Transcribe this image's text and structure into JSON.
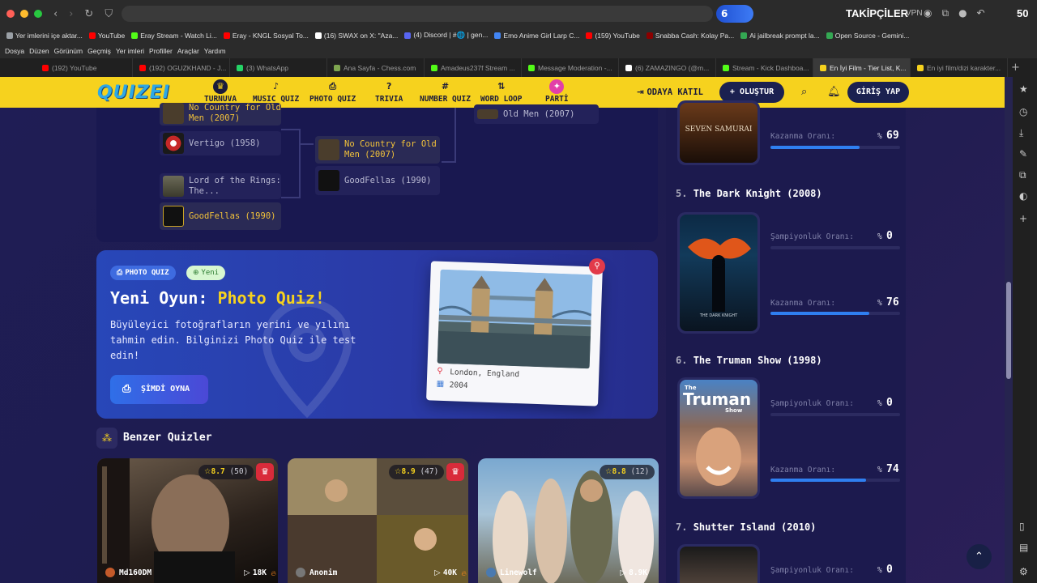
{
  "browser": {
    "extension_count": "6",
    "overlay_text": "TAKİPÇİLER",
    "vpn_text": "VPN",
    "counter": "50",
    "bookmarks": [
      {
        "label": "Yer imlerini içe aktar...",
        "color": "#9aa0a6"
      },
      {
        "label": "YouTube",
        "color": "#ff0000"
      },
      {
        "label": "Eray Stream - Watch Li...",
        "color": "#53fc18"
      },
      {
        "label": "Eray - KNGL Sosyal To...",
        "color": "#ff0000"
      },
      {
        "label": "(16) SWAX on X: \"Aza...",
        "color": "#ffffff"
      },
      {
        "label": "(4) Discord | #🌐 | gen...",
        "color": "#5865f2"
      },
      {
        "label": "Emo Anime Girl Larp C...",
        "color": "#4285f4"
      },
      {
        "label": "(159) YouTube",
        "color": "#ff0000"
      },
      {
        "label": "Snabba Cash: Kolay Pa...",
        "color": "#8b0000"
      },
      {
        "label": "Ai jailbreak prompt la...",
        "color": "#34a853"
      },
      {
        "label": "Open Source - Gemini...",
        "color": "#34a853"
      }
    ],
    "menu": [
      "Dosya",
      "Düzen",
      "Görünüm",
      "Geçmiş",
      "Yer imleri",
      "Profiller",
      "Araçlar",
      "Yardım"
    ],
    "tabs": [
      {
        "label": "(192) YouTube",
        "color": "#ff0000",
        "active": false
      },
      {
        "label": "(192) OGUZKHAND - J...",
        "color": "#ff0000",
        "active": false
      },
      {
        "label": "(3) WhatsApp",
        "color": "#25d366",
        "active": false
      },
      {
        "label": "Ana Sayfa - Chess.com",
        "color": "#7fa650",
        "active": false
      },
      {
        "label": "Amadeus237f Stream ...",
        "color": "#53fc18",
        "active": false
      },
      {
        "label": "Message Moderation -...",
        "color": "#53fc18",
        "active": false
      },
      {
        "label": "(6) ZAMAZINGO (@m...",
        "color": "#ffffff",
        "active": false
      },
      {
        "label": "Stream - Kick Dashboa...",
        "color": "#53fc18",
        "active": false
      },
      {
        "label": "En İyi Film - Tier List, K...",
        "color": "#f6d21e",
        "active": true
      },
      {
        "label": "En iyi film/dizi karakter...",
        "color": "#f6d21e",
        "active": false
      }
    ]
  },
  "header": {
    "logo": "QUIZEI",
    "nav": [
      {
        "label": "TURNUVA",
        "icon": "trophy-icon"
      },
      {
        "label": "MUSIC QUIZ",
        "icon": "music-note-icon"
      },
      {
        "label": "PHOTO QUIZ",
        "icon": "camera-icon"
      },
      {
        "label": "TRIVIA",
        "icon": "question-icon"
      },
      {
        "label": "NUMBER QUIZ",
        "icon": "hash-icon"
      },
      {
        "label": "WORD LOOP",
        "icon": "sort-icon"
      },
      {
        "label": "PARTİ",
        "icon": "party-icon"
      }
    ],
    "join_room": "ODAYA KATIL",
    "create": "+ OLUŞTUR",
    "login": "GİRİŞ YAP"
  },
  "bracket": {
    "slots": [
      {
        "title": "No Country for Old Men (2007)",
        "winner": true
      },
      {
        "title": "Vertigo (1958)",
        "winner": false
      },
      {
        "title": "Lord of the Rings: The...",
        "winner": false
      },
      {
        "title": "GoodFellas (1990)",
        "winner": true
      },
      {
        "title": "No Country for Old Men (2007)",
        "winner": true
      },
      {
        "title": "GoodFellas (1990)",
        "winner": false
      },
      {
        "title": "Old Men (2007)",
        "winner": false
      }
    ]
  },
  "photo_quiz": {
    "tag": "PHOTO QUIZ",
    "new_badge": "Yeni",
    "title_prefix": "Yeni Oyun:",
    "title_highlight": "Photo Quiz!",
    "description": "Büyüleyici fotoğrafların yerini ve yılını tahmin edin. Bilginizi Photo Quiz ile test edin!",
    "button": "ŞİMDİ OYNA",
    "location": "London, England",
    "year": "2004"
  },
  "similar": {
    "title": "Benzer Quizler",
    "cards": [
      {
        "rating": "8.7",
        "count": "(50)",
        "author": "Md160DM",
        "plays": "18K"
      },
      {
        "rating": "8.9",
        "count": "(47)",
        "author": "Anonim",
        "plays": "40K"
      },
      {
        "rating": "8.8",
        "count": "(12)",
        "author": "Linewolf",
        "plays": "8.9K"
      }
    ]
  },
  "ranking": {
    "items": [
      {
        "stats": [
          {
            "label": "Kazanma Oranı:",
            "value": "69",
            "fraction": 0.69
          }
        ]
      },
      {
        "rank": "5.",
        "title": "The Dark Knight (2008)",
        "stats": [
          {
            "label": "Şampiyonluk Oranı:",
            "value": "0",
            "fraction": 0
          },
          {
            "label": "Kazanma Oranı:",
            "value": "76",
            "fraction": 0.76
          }
        ]
      },
      {
        "rank": "6.",
        "title": "The Truman Show (1998)",
        "stats": [
          {
            "label": "Şampiyonluk Oranı:",
            "value": "0",
            "fraction": 0
          },
          {
            "label": "Kazanma Oranı:",
            "value": "74",
            "fraction": 0.74
          }
        ]
      },
      {
        "rank": "7.",
        "title": "Shutter Island (2010)",
        "stats": [
          {
            "label": "Şampiyonluk Oranı:",
            "value": "0",
            "fraction": 0
          }
        ]
      }
    ],
    "poster_texts": {
      "seven_samurai": "SEVEN SAMURAI",
      "dark_knight": "THE DARK KNIGHT",
      "truman": "Truman",
      "truman_sub": "Show",
      "truman_top": "The"
    },
    "percent_sign": "%"
  },
  "colors": {
    "accent_yellow": "#f6d21e",
    "header_dark": "#1b2150",
    "bar_blue": "#2f7ff0"
  }
}
